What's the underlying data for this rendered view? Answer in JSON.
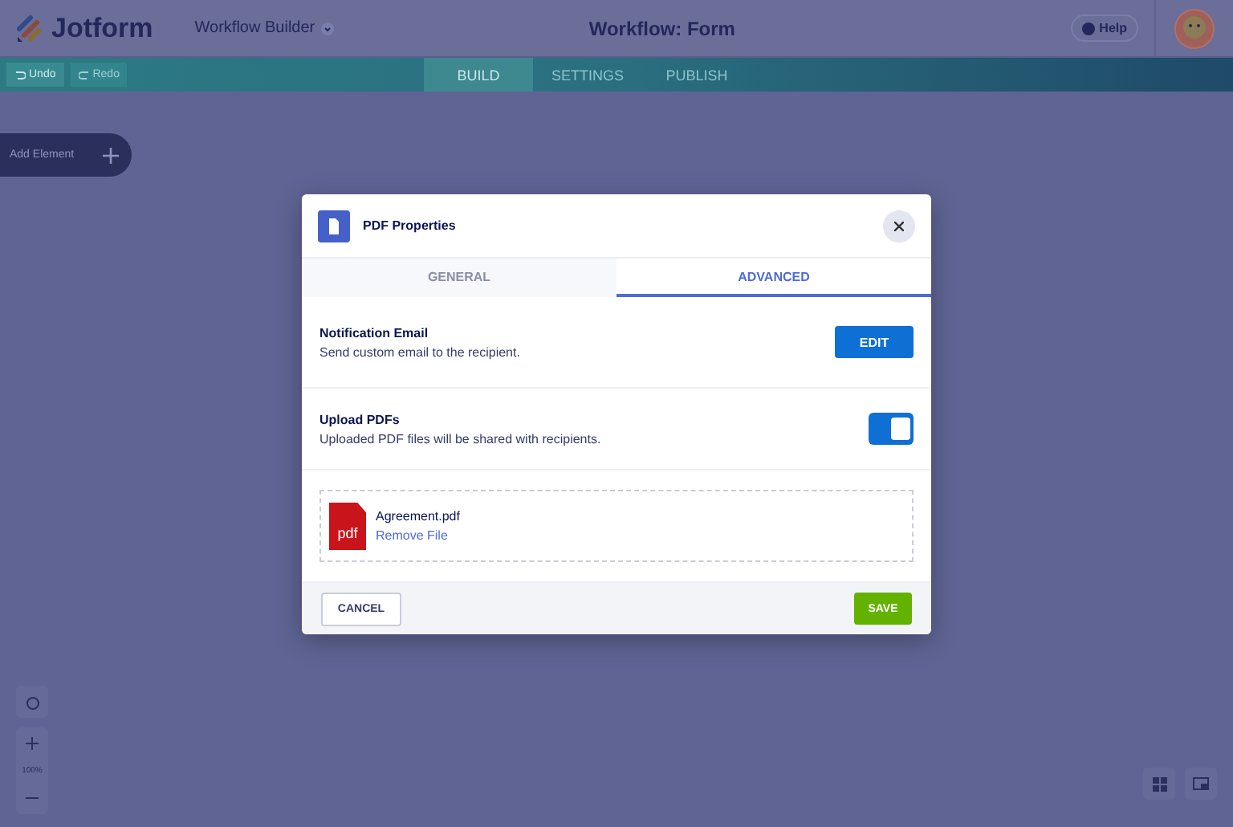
{
  "header": {
    "logo": "Jotform",
    "app_switcher": "Workflow Builder",
    "title": "Workflow: Form",
    "help": "Help"
  },
  "toolbar": {
    "actions": [
      {
        "label": "Undo",
        "disabled": false
      },
      {
        "label": "Redo",
        "disabled": true
      }
    ],
    "tabs": [
      {
        "label": "BUILD",
        "selected": true
      },
      {
        "label": "SETTINGS",
        "selected": false
      },
      {
        "label": "PUBLISH",
        "selected": false
      }
    ]
  },
  "add_element": "Add Element",
  "zoom": {
    "level_label": "100%"
  },
  "dialog": {
    "title": "PDF Properties",
    "tabs": [
      {
        "label": "GENERAL",
        "selected": false
      },
      {
        "label": "ADVANCED",
        "selected": true
      }
    ],
    "settings": [
      {
        "kind": "button",
        "title": "Notification Email",
        "description": "Send custom email to the recipient.",
        "button": "EDIT"
      },
      {
        "kind": "toggle",
        "title": "Upload PDFs",
        "description": "Uploaded PDF files will be shared with recipients.",
        "on": true
      }
    ],
    "file": {
      "badge": "pdf",
      "name": "Agreement.pdf",
      "action": "Remove File"
    },
    "cancel": "CANCEL",
    "save": "SAVE"
  }
}
